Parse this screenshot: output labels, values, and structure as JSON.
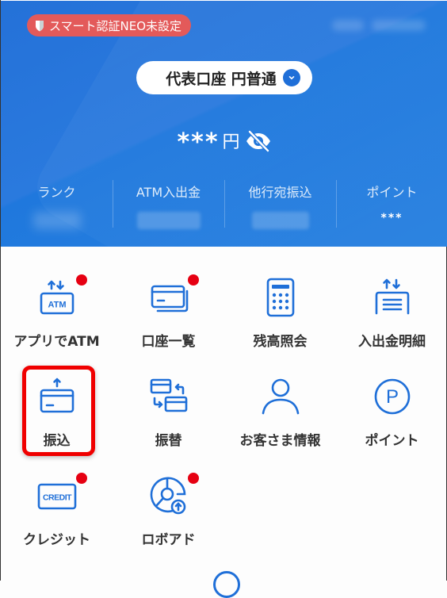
{
  "header": {
    "neo_badge": {
      "icon": "shield-icon",
      "label": "スマート認証NEO未設定"
    },
    "account_selector": {
      "label": "代表口座 円普通",
      "icon": "chevron-down-icon"
    },
    "balance": {
      "masked_value": "***",
      "unit": "円",
      "visibility_icon": "eye-off-icon"
    },
    "stats": [
      {
        "label": "ランク",
        "value": null
      },
      {
        "label": "ATM入出金",
        "value": null
      },
      {
        "label": "他行宛振込",
        "value": null
      },
      {
        "label": "ポイント",
        "value": "***"
      }
    ]
  },
  "menu": {
    "items": [
      {
        "label": "アプリでATM",
        "icon": "atm-icon",
        "badge": true,
        "atm_text": "ATM"
      },
      {
        "label": "口座一覧",
        "icon": "account-list-icon",
        "badge": true
      },
      {
        "label": "残高照会",
        "icon": "calculator-icon",
        "badge": false
      },
      {
        "label": "入出金明細",
        "icon": "statement-icon",
        "badge": false
      },
      {
        "label": "振込",
        "icon": "transfer-icon",
        "badge": false,
        "highlighted": true
      },
      {
        "label": "振替",
        "icon": "swap-accounts-icon",
        "badge": false
      },
      {
        "label": "お客さま情報",
        "icon": "person-icon",
        "badge": false
      },
      {
        "label": "ポイント",
        "icon": "points-icon",
        "badge": false,
        "points_text": "P"
      },
      {
        "label": "クレジット",
        "icon": "credit-card-icon",
        "badge": true,
        "credit_text": "CREDIT"
      },
      {
        "label": "ロボアド",
        "icon": "robo-advisor-icon",
        "badge": true
      }
    ]
  },
  "colors": {
    "brand_blue": "#1f6fd8",
    "badge_red": "#e60012",
    "neo_badge": "#e35a5a",
    "highlight": "#f00000"
  }
}
